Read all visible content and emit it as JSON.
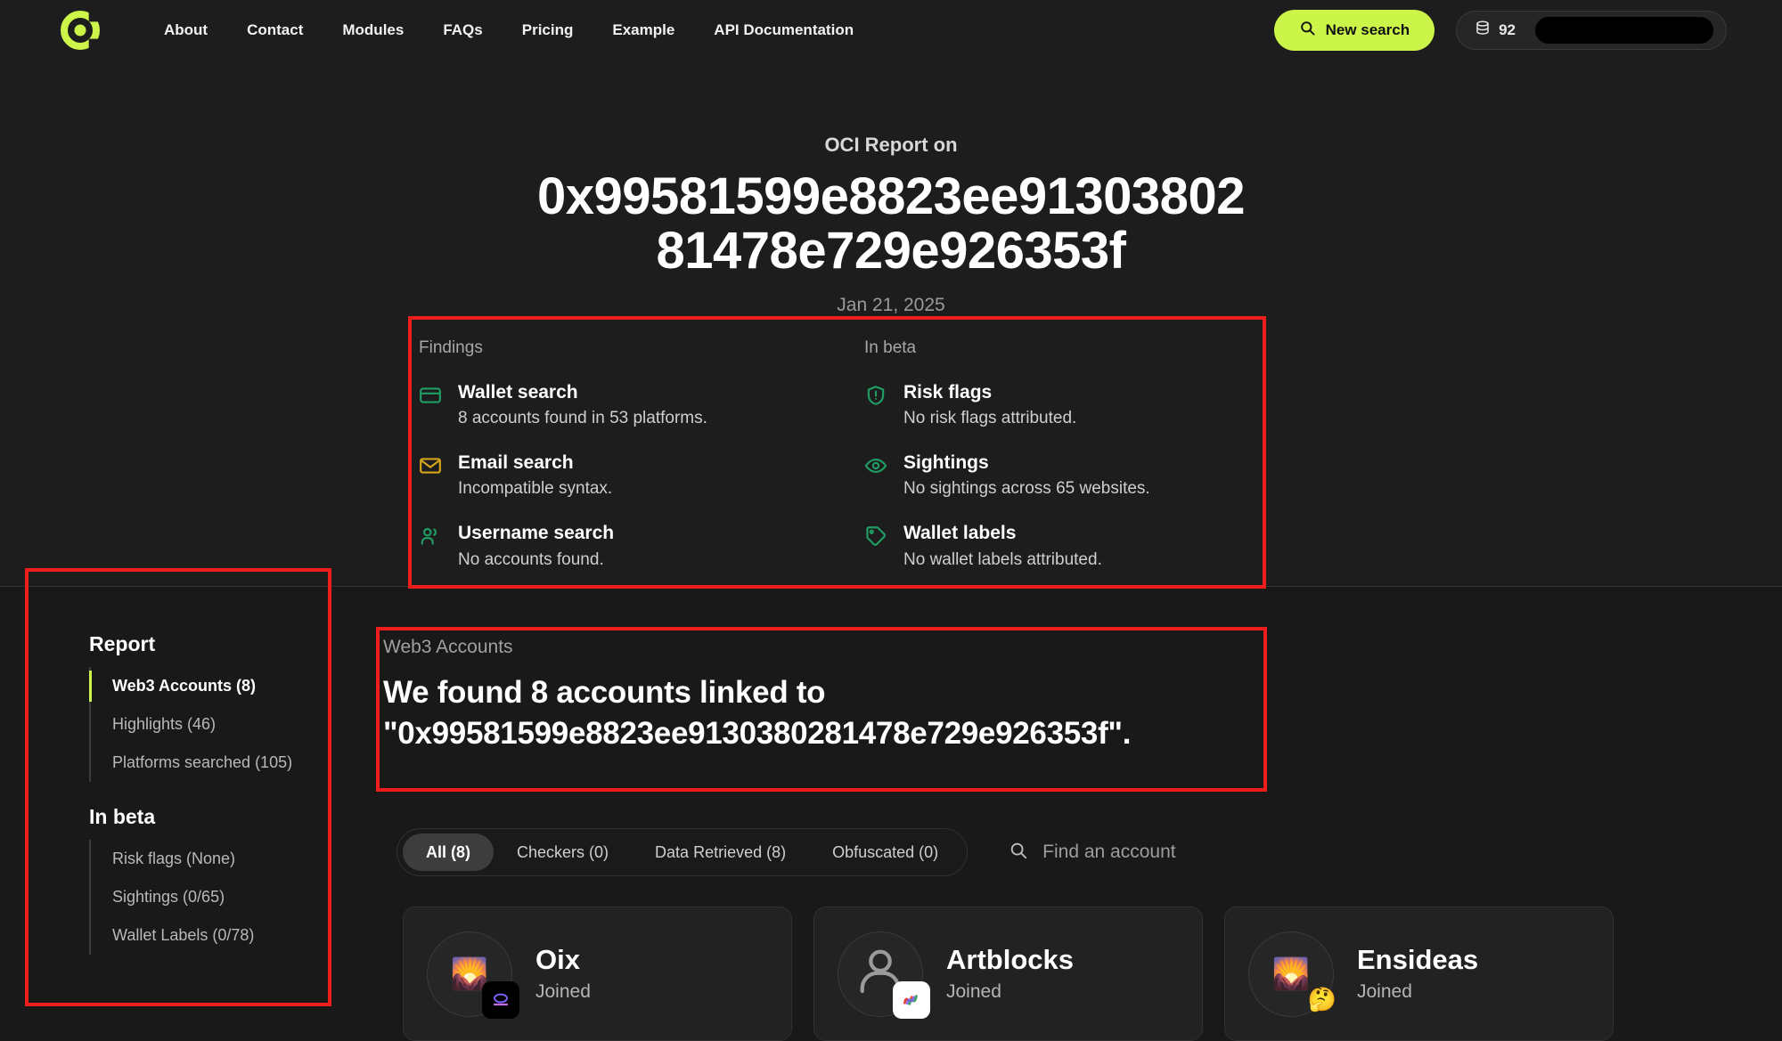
{
  "brand": {
    "logo_name": "OSINT Industries logo",
    "accent": "#ccf54a"
  },
  "nav": {
    "links": [
      {
        "label": "About"
      },
      {
        "label": "Contact"
      },
      {
        "label": "Modules"
      },
      {
        "label": "FAQs"
      },
      {
        "label": "Pricing"
      },
      {
        "label": "Example"
      },
      {
        "label": "API Documentation"
      }
    ],
    "new_search_label": "New search",
    "credits_count": "92",
    "account_redacted": ""
  },
  "report": {
    "kicker": "OCI Report on",
    "address_line1": "0x99581599e8823ee91303802",
    "address_line2": "81478e729e926353f",
    "date": "Jan 21, 2025"
  },
  "findings": {
    "left_title": "Findings",
    "right_title": "In beta",
    "left_items": [
      {
        "name": "Wallet search",
        "desc": "8 accounts found in 53 platforms.",
        "icon": "credit-card-icon",
        "color": "#1f9d63"
      },
      {
        "name": "Email search",
        "desc": "Incompatible syntax.",
        "icon": "envelope-icon",
        "color": "#d5a41b"
      },
      {
        "name": "Username search",
        "desc": "No accounts found.",
        "icon": "users-icon",
        "color": "#1f9d63"
      }
    ],
    "right_items": [
      {
        "name": "Risk flags",
        "desc": "No risk flags attributed.",
        "icon": "shield-alert-icon",
        "color": "#1f9d63"
      },
      {
        "name": "Sightings",
        "desc": "No sightings across 65 websites.",
        "icon": "eye-icon",
        "color": "#1f9d63"
      },
      {
        "name": "Wallet labels",
        "desc": "No wallet labels attributed.",
        "icon": "tag-icon",
        "color": "#1f9d63"
      }
    ]
  },
  "sidebar": {
    "report_heading": "Report",
    "report_items": [
      {
        "label": "Web3 Accounts (8)",
        "active": true
      },
      {
        "label": "Highlights (46)",
        "active": false
      },
      {
        "label": "Platforms searched (105)",
        "active": false
      }
    ],
    "beta_heading": "In beta",
    "beta_items": [
      {
        "label": "Risk flags (None)",
        "active": false
      },
      {
        "label": "Sightings (0/65)",
        "active": false
      },
      {
        "label": "Wallet Labels (0/78)",
        "active": false
      }
    ]
  },
  "web3": {
    "kicker": "Web3 Accounts",
    "title_line1": "We found 8 accounts linked to",
    "title_line2": "\"0x99581599e8823ee9130380281478e729e926353f\".",
    "tabs": [
      {
        "label": "All (8)",
        "active": true
      },
      {
        "label": "Checkers (0)",
        "active": false
      },
      {
        "label": "Data Retrieved (8)",
        "active": false
      },
      {
        "label": "Obfuscated (0)",
        "active": false
      }
    ],
    "search_placeholder": "Find an account",
    "accounts": [
      {
        "name": "Oix",
        "status": "Joined",
        "avatar_glyph": "🌄",
        "badge_glyph": "⬭",
        "badge_style": "dark"
      },
      {
        "name": "Artblocks",
        "status": "Joined",
        "avatar_glyph": "person-silhouette",
        "badge_glyph": "〜",
        "badge_style": "light"
      },
      {
        "name": "Ensideas",
        "status": "Joined",
        "avatar_glyph": "🌄",
        "badge_glyph": "🤔",
        "badge_style": "plain"
      }
    ]
  },
  "annotations": {
    "findings_box": "red-highlight-findings",
    "sidebar_box": "red-highlight-sidebar",
    "web3_box": "red-highlight-web3-summary"
  }
}
